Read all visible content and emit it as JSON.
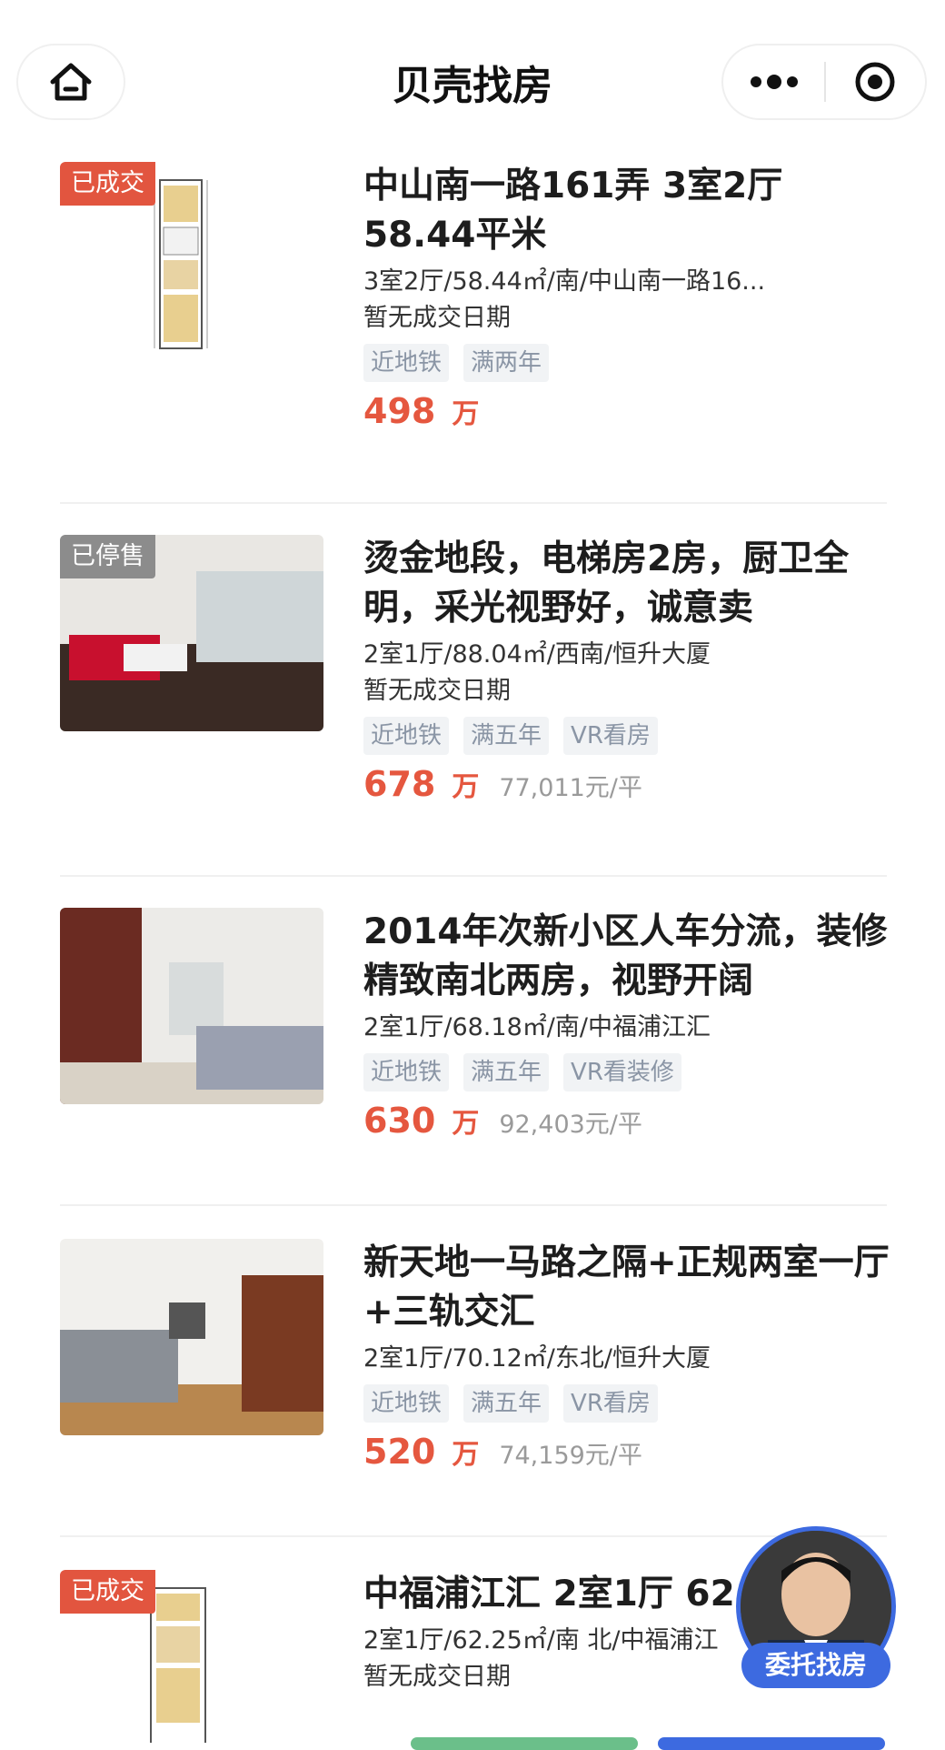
{
  "header": {
    "title": "贝壳找房"
  },
  "listings": [
    {
      "badge": "已成交",
      "title": "中山南一路161弄 3室2厅 58.44平米",
      "details": "3室2厅/58.44㎡/南/中山南一路16...",
      "date": "暂无成交日期",
      "tags": [
        "近地铁",
        "满两年"
      ],
      "price": "498",
      "unit": "万",
      "per_sqm": ""
    },
    {
      "badge": "已停售",
      "title": "烫金地段，电梯房2房，厨卫全明，采光视野好，诚意卖",
      "details": "2室1厅/88.04㎡/西南/恒升大厦",
      "date": "暂无成交日期",
      "tags": [
        "近地铁",
        "满五年",
        "VR看房"
      ],
      "price": "678",
      "unit": "万",
      "per_sqm": "77,011元/平"
    },
    {
      "badge": "",
      "title": "2014年次新小区人车分流，装修精致南北两房，视野开阔",
      "details": "2室1厅/68.18㎡/南/中福浦江汇",
      "date": "",
      "tags": [
        "近地铁",
        "满五年",
        "VR看装修"
      ],
      "price": "630",
      "unit": "万",
      "per_sqm": "92,403元/平"
    },
    {
      "badge": "",
      "title": "新天地一马路之隔+正规两室一厅+三轨交汇",
      "details": "2室1厅/70.12㎡/东北/恒升大厦",
      "date": "",
      "tags": [
        "近地铁",
        "满五年",
        "VR看房"
      ],
      "price": "520",
      "unit": "万",
      "per_sqm": "74,159元/平"
    },
    {
      "badge": "已成交",
      "title": "中福浦江汇 2室1厅 62",
      "details": "2室1厅/62.25㎡/南 北/中福浦江",
      "date": "暂无成交日期",
      "tags": [],
      "price": "",
      "unit": "",
      "per_sqm": ""
    }
  ],
  "agent": {
    "label": "委托找房"
  },
  "colors": {
    "accent": "#e5573f",
    "agent_blue": "#3d6ae0"
  }
}
